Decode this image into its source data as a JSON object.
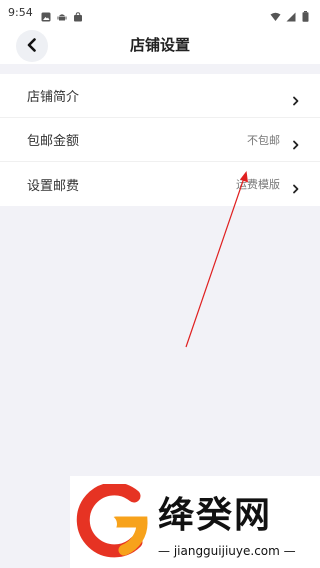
{
  "status_bar": {
    "time": "9:54",
    "left_icons": [
      "photo-icon",
      "android-icon",
      "bag-icon"
    ],
    "right_icons": [
      "wifi-icon",
      "signal-icon",
      "battery-icon"
    ]
  },
  "nav": {
    "title": "店铺设置",
    "back_icon": "chevron-left-icon"
  },
  "settings": {
    "rows": [
      {
        "label": "店铺简介",
        "value": ""
      },
      {
        "label": "包邮金额",
        "value": "不包邮"
      },
      {
        "label": "设置邮费",
        "value": "运费模版"
      }
    ]
  },
  "watermark": {
    "title": "绛癸网",
    "subtitle": "— jiangguijiuye.com —"
  },
  "colors": {
    "background": "#f2f2f7",
    "annotation_arrow": "#e02020",
    "logo_red": "#e63323",
    "logo_orange": "#f7a21b"
  }
}
